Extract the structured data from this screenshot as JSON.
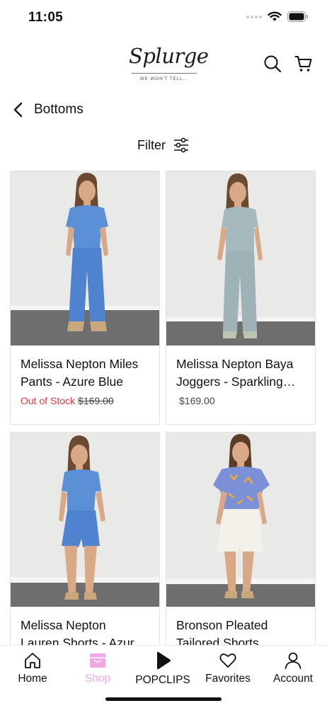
{
  "status_bar": {
    "time": "11:05"
  },
  "header": {
    "logo_text": "Splurge",
    "logo_tagline": "WE WON'T TELL...",
    "icons": [
      "search-icon",
      "cart-icon"
    ]
  },
  "page": {
    "title": "Bottoms",
    "back_icon": "chevron-left-icon"
  },
  "filter": {
    "label": "Filter",
    "icon": "sliders-icon"
  },
  "products": [
    {
      "name_line1": "Melissa Nepton Miles",
      "name_line2": "Pants - Azure Blue",
      "stock_status": "Out of Stock",
      "price": "$169.00",
      "outfit_color": "#5b8fd6",
      "outfit_type": "pants"
    },
    {
      "name_line1": "Melissa Nepton Baya",
      "name_line2": "Joggers - Sparkling…",
      "stock_status": "",
      "price": "$169.00",
      "outfit_color": "#a6b9bd",
      "outfit_type": "pants"
    },
    {
      "name_line1": "Melissa Nepton",
      "name_line2": "Lauren Shorts - Azur…",
      "stock_status": "",
      "price": "",
      "outfit_color": "#5b8fd6",
      "outfit_type": "shorts"
    },
    {
      "name_line1": "Bronson Pleated",
      "name_line2": "Tailored Shorts",
      "stock_status": "",
      "price": "",
      "outfit_color": "#f3f1ea",
      "outfit_type": "white-shorts"
    }
  ],
  "tab_bar": {
    "active": "Shop",
    "tabs": [
      {
        "label": "Home",
        "icon": "home-icon"
      },
      {
        "label": "Shop",
        "icon": "shopping-bag-icon"
      },
      {
        "label": "POPCLIPS",
        "icon": "play-icon"
      },
      {
        "label": "Favorites",
        "icon": "heart-icon"
      },
      {
        "label": "Account",
        "icon": "user-icon"
      }
    ]
  },
  "colors": {
    "accent_pink": "#f0a6e6",
    "out_of_stock": "#e03a3e"
  }
}
